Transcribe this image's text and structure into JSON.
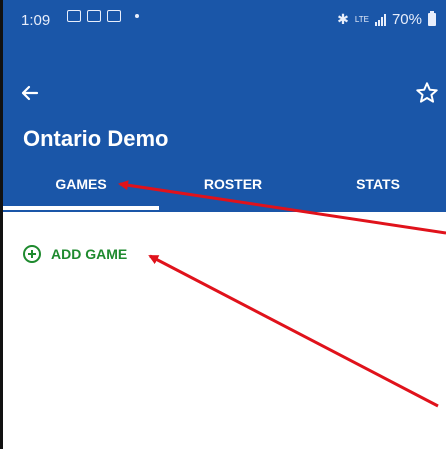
{
  "status_bar": {
    "time": "1:09",
    "network": "LTE",
    "battery": "70%"
  },
  "header": {
    "title": "Ontario Demo"
  },
  "tabs": [
    {
      "label": "GAMES",
      "selected": true
    },
    {
      "label": "ROSTER",
      "selected": false
    },
    {
      "label": "STATS",
      "selected": false
    }
  ],
  "content": {
    "add_game_label": "ADD GAME"
  },
  "colors": {
    "appbar": "#1a56a8",
    "accent_green": "#1e8a2e",
    "annotation_arrow": "#e0121b"
  }
}
